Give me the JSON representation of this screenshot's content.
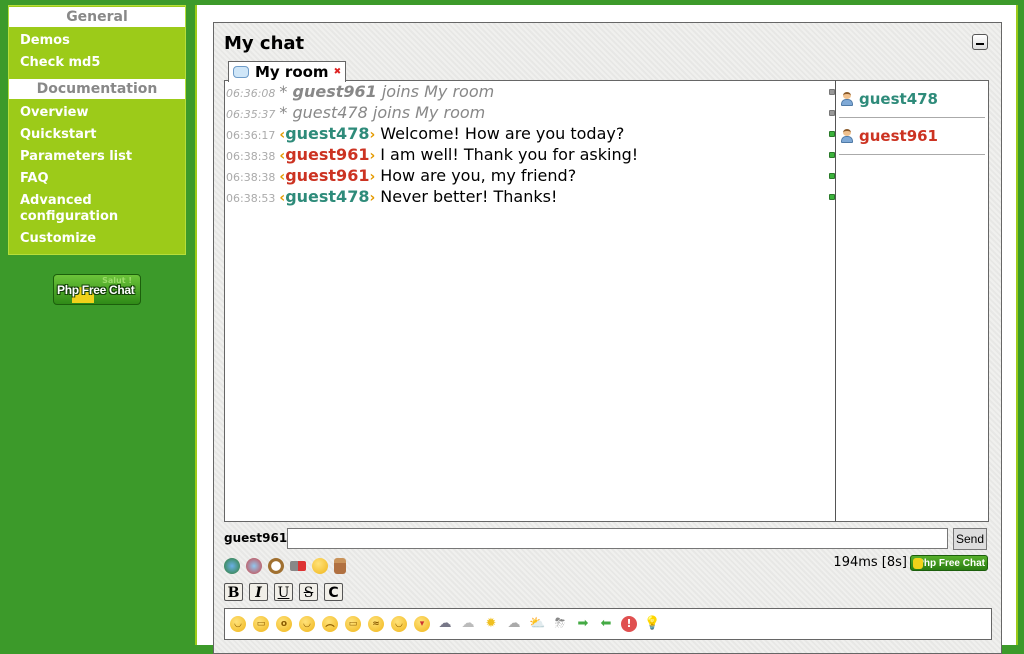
{
  "sidebar": {
    "sections": [
      {
        "header": "General",
        "items": [
          "Demos",
          "Check md5"
        ]
      },
      {
        "header": "Documentation",
        "items": [
          "Overview",
          "Quickstart",
          "Parameters list",
          "FAQ",
          "Advanced configuration",
          "Customize"
        ]
      }
    ],
    "logo": {
      "text": "Php Free Chat",
      "tagline": "Salut !"
    }
  },
  "chat": {
    "title": "My chat",
    "tab": {
      "label": "My room",
      "icon": "chat-bubble-icon",
      "close_icon": "close-icon"
    },
    "messages": [
      {
        "time": "06:36:08",
        "type": "system",
        "prefix": "* ",
        "nick": "guest961",
        "text": " joins My room",
        "status": "grey"
      },
      {
        "time": "06:35:37",
        "type": "system",
        "prefix": "* ",
        "nick": "guest478",
        "text": " joins My room",
        "status": "grey"
      },
      {
        "time": "06:36:17",
        "type": "message",
        "nick": "guest478",
        "nick_color": "#2e8b7a",
        "text": "Welcome! How are you today?",
        "status": "green"
      },
      {
        "time": "06:38:38",
        "type": "message",
        "nick": "guest961",
        "nick_color": "#cc3322",
        "text": "I am well! Thank you for asking!",
        "status": "green"
      },
      {
        "time": "06:38:38",
        "type": "message",
        "nick": "guest961",
        "nick_color": "#cc3322",
        "text": "How are you, my friend?",
        "status": "green"
      },
      {
        "time": "06:38:53",
        "type": "message",
        "nick": "guest478",
        "nick_color": "#2e8b7a",
        "text": "Never better! Thanks!",
        "status": "green"
      }
    ],
    "users": [
      {
        "nick": "guest478",
        "color": "#2e8b7a"
      },
      {
        "nick": "guest961",
        "color": "#cc3322"
      }
    ],
    "input": {
      "label": "guest961",
      "value": "",
      "placeholder": ""
    },
    "send_label": "Send",
    "status_text": "194ms [8s]",
    "mini_logo_text": "Php Free Chat",
    "command_icons": [
      "connect-icon",
      "whois-icon",
      "clock-icon",
      "sound-icon",
      "smiley-toggle-icon",
      "nicklist-toggle-icon"
    ],
    "format_buttons": [
      "B",
      "I",
      "U",
      "S",
      "C"
    ],
    "smileys": [
      "smile",
      "big-grin",
      "surprised",
      "grin",
      "sad",
      "laugh",
      "squint",
      "happy",
      "tongue",
      "rain",
      "snow",
      "sun",
      "clouds",
      "sun-cloud",
      "storm",
      "arrow-right",
      "arrow-left",
      "exclamation",
      "lightbulb"
    ]
  }
}
